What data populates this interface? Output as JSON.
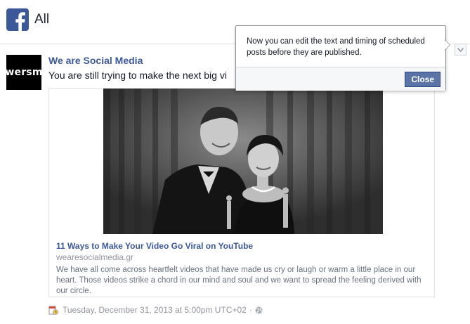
{
  "header": {
    "title": "All",
    "logo_icon": "facebook-f-icon"
  },
  "post": {
    "author": "We are Social Media",
    "avatar_text": "wersm",
    "text": "You are still trying to make the next big vi",
    "attachment": {
      "title": "11 Ways to Make Your Video Go Viral on YouTube",
      "domain": "wearesocialmedia.gr",
      "description": "We have all come across heartfelt videos that have made us cry or laugh or warm a little place in our heart. Those videos strike a chord in our mind and soul and we want to spread the feeling derived with our circle."
    },
    "footer": {
      "timestamp": "Tuesday, December 31, 2013 at 5:00pm UTC+02",
      "separator": "·",
      "schedule_icon": "scheduled-post-icon",
      "privacy_icon": "globe-icon"
    }
  },
  "tooltip": {
    "message": "Now you can edit the text and timing of scheduled posts before they are published.",
    "close_label": "Close"
  },
  "colors": {
    "brand": "#3b5998",
    "link": "#3b5998",
    "muted": "#90949c",
    "button": "#5b74a8"
  }
}
